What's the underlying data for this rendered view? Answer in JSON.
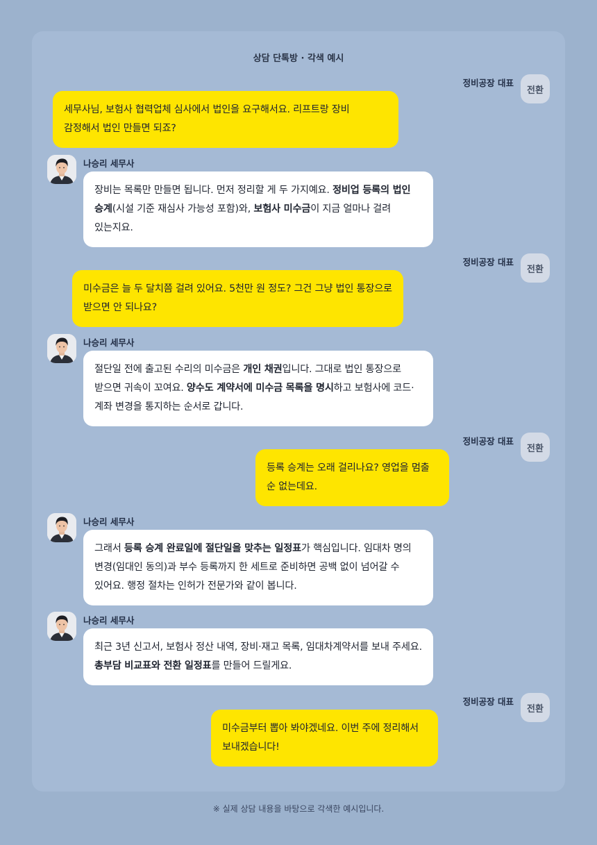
{
  "room_title": "상담 단톡방 · 각색 예시",
  "owner": {
    "name": "정비공장 대표",
    "avatar_text": "전환"
  },
  "advisor": {
    "name": "나승리 세무사"
  },
  "messages": [
    {
      "sender": "owner",
      "segments": [
        {
          "t": "세무사님, 보험사 협력업체 심사에서 법인을 요구해서요. 리프트랑 장비 감정해서 법인 만들면 되죠?"
        }
      ]
    },
    {
      "sender": "advisor",
      "segments": [
        {
          "t": "장비는 목록만 만들면 됩니다. 먼저 정리할 게 두 가지예요. "
        },
        {
          "t": "정비업 등록의 법인 승계",
          "b": true
        },
        {
          "t": "(시설 기준 재심사 가능성 포함)와, "
        },
        {
          "t": "보험사 미수금",
          "b": true
        },
        {
          "t": "이 지금 얼마나 걸려 있는지요."
        }
      ]
    },
    {
      "sender": "owner",
      "segments": [
        {
          "t": "미수금은 늘 두 달치쯤 걸려 있어요. 5천만 원 정도? 그건 그냥 법인 통장으로 받으면 안 되나요?"
        }
      ]
    },
    {
      "sender": "advisor",
      "segments": [
        {
          "t": "절단일 전에 출고된 수리의 미수금은 "
        },
        {
          "t": "개인 채권",
          "b": true
        },
        {
          "t": "입니다. 그대로 법인 통장으로 받으면 귀속이 꼬여요. "
        },
        {
          "t": "양수도 계약서에 미수금 목록을 명시",
          "b": true
        },
        {
          "t": "하고 보험사에 코드·계좌 변경을 통지하는 순서로 갑니다."
        }
      ]
    },
    {
      "sender": "owner",
      "segments": [
        {
          "t": "등록 승계는 오래 걸리나요? 영업을 멈출 순 없는데요."
        }
      ]
    },
    {
      "sender": "advisor",
      "segments": [
        {
          "t": "그래서 "
        },
        {
          "t": "등록 승계 완료일에 절단일을 맞추는 일정표",
          "b": true
        },
        {
          "t": "가 핵심입니다. 임대차 명의 변경(임대인 동의)과 부수 등록까지 한 세트로 준비하면 공백 없이 넘어갈 수 있어요. 행정 절차는 인허가 전문가와 같이 봅니다."
        }
      ]
    },
    {
      "sender": "advisor",
      "segments": [
        {
          "t": "최근 3년 신고서, 보험사 정산 내역, 장비·재고 목록, 임대차계약서를 보내 주세요. "
        },
        {
          "t": "총부담 비교표와 전환 일정표",
          "b": true
        },
        {
          "t": "를 만들어 드릴게요."
        }
      ]
    },
    {
      "sender": "owner",
      "segments": [
        {
          "t": "미수금부터 뽑아 봐야겠네요. 이번 주에 정리해서 보내겠습니다!"
        }
      ]
    }
  ],
  "footnote": "※ 실제 상담 내용을 바탕으로 각색한 예시입니다.",
  "colors": {
    "background": "#9cb2cd",
    "panel": "#a5bad5",
    "owner_bubble": "#fee500",
    "advisor_bubble": "#ffffff"
  }
}
